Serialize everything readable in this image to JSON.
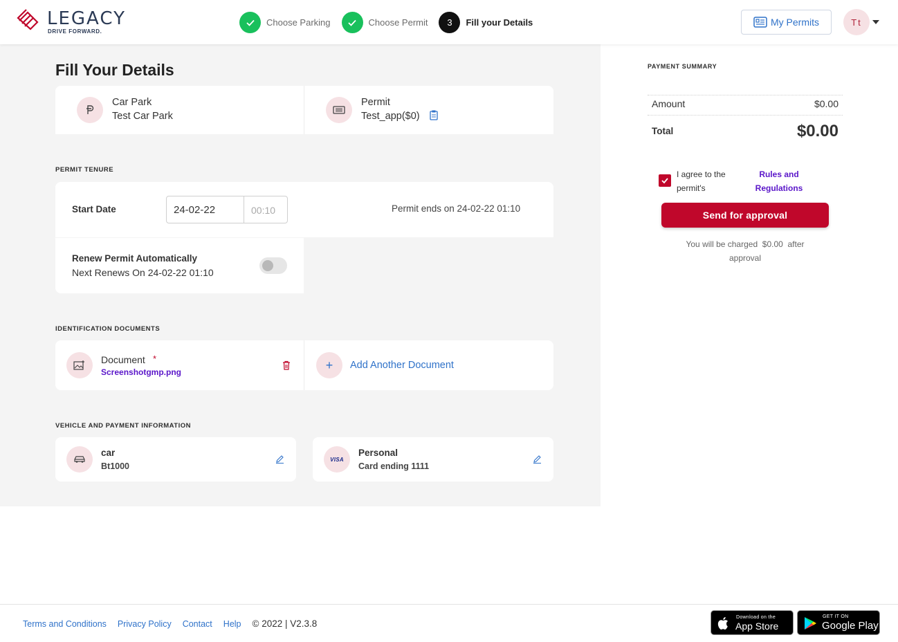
{
  "header": {
    "brand": "LEGACY",
    "tagline": "DRIVE FORWARD.",
    "steps": [
      {
        "label": "Choose Parking",
        "status": "done"
      },
      {
        "label": "Choose Permit",
        "status": "done"
      },
      {
        "label": "Fill your Details",
        "status": "active",
        "number": "3"
      }
    ],
    "my_permits": "My Permits",
    "avatar_initials": "Tt"
  },
  "page": {
    "title": "Fill Your Details"
  },
  "selection": {
    "car_park_label": "Car Park",
    "car_park_value": "Test Car Park",
    "permit_label": "Permit",
    "permit_value": "Test_app($0)"
  },
  "tenure": {
    "section_title": "PERMIT TENURE",
    "start_date_label": "Start Date",
    "start_date_value": "24-02-22",
    "start_time_value": "00:10",
    "permit_ends": "Permit ends on 24-02-22 01:10",
    "renew_label": "Renew Permit Automatically",
    "renew_next": "Next Renews On 24-02-22 01:10",
    "renew_enabled": false
  },
  "documents": {
    "section_title": "IDENTIFICATION DOCUMENTS",
    "document_label": "Document",
    "required_mark": "*",
    "document_file": "Screenshotgmp.png",
    "add_another": "Add Another Document"
  },
  "vehicle_payment": {
    "section_title": "VEHICLE AND PAYMENT INFORMATION",
    "vehicle_type": "car",
    "vehicle_plate": "Bt1000",
    "card_badge": "VISA",
    "payment_name": "Personal",
    "payment_card": "Card ending 1111"
  },
  "summary": {
    "title": "PAYMENT SUMMARY",
    "amount_label": "Amount",
    "amount_value": "$0.00",
    "total_label": "Total",
    "total_value": "$0.00",
    "agree_line1": "I agree to the",
    "agree_line2": "permit's",
    "rules_line1": "Rules and",
    "rules_line2": "Regulations",
    "agree_checked": true,
    "send_button": "Send for approval",
    "charge_prefix": "You will be charged",
    "charge_amount": "$0.00",
    "charge_suffix": "after",
    "charge_line2": "approval"
  },
  "footer": {
    "links": [
      "Terms and Conditions",
      "Privacy Policy",
      "Contact",
      "Help"
    ],
    "copyright": "© 2022 | V2.3.8",
    "app_store_small": "Download on the",
    "app_store_big": "App Store",
    "google_play_small": "GET IT ON",
    "google_play_big": "Google Play"
  },
  "colors": {
    "brand_red": "#c0072b",
    "success_green": "#19c05c",
    "link_blue": "#2f72c9",
    "purple": "#5a16c9",
    "icon_bg": "#f6e1e4"
  }
}
